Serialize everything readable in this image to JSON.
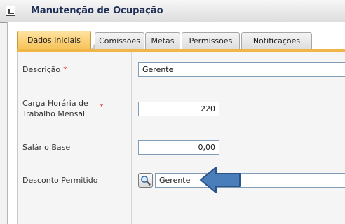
{
  "window": {
    "title": "Manutenção de Ocupação"
  },
  "tabs": [
    {
      "label": "Dados Iniciais",
      "active": true
    },
    {
      "label": "Comissões",
      "active": false
    },
    {
      "label": "Metas",
      "active": false
    },
    {
      "label": "Permissões",
      "active": false
    },
    {
      "label": "Notificações",
      "active": false
    }
  ],
  "form": {
    "descricao": {
      "label": "Descrição",
      "required_mark": "*",
      "value": "Gerente"
    },
    "carga_horaria": {
      "label_line1": "Carga Horária de",
      "label_line2": "Trabalho Mensal",
      "required_mark": "*",
      "value": "220"
    },
    "salario_base": {
      "label": "Salário Base",
      "value": "0,00"
    },
    "desconto_permitido": {
      "label": "Desconto Permitido",
      "value": "Gerente",
      "lookup_icon": "magnifier-icon"
    }
  },
  "annotation": {
    "icon": "arrow-left-icon",
    "color": "#4a7ebb"
  },
  "colors": {
    "active_tab": "#f6c35a",
    "accent_line": "#f1b648",
    "required": "#e03030",
    "title": "#1f2f56"
  }
}
